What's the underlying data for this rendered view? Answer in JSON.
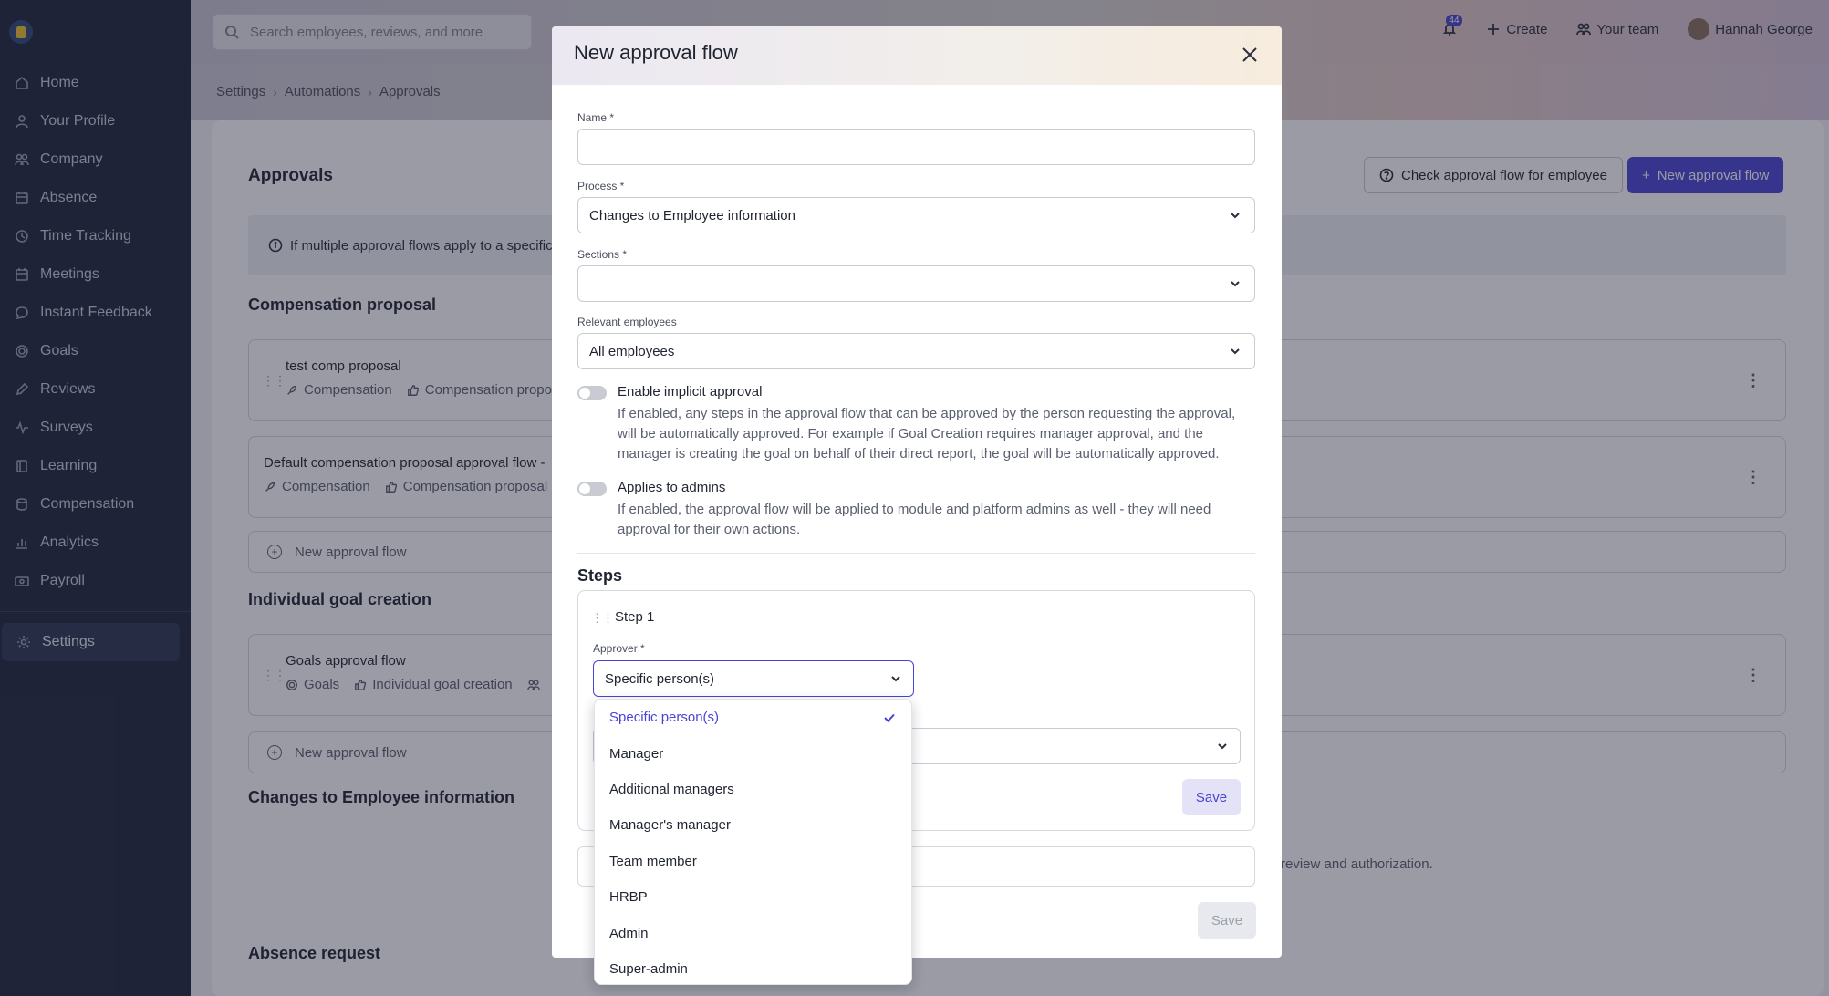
{
  "topbar": {
    "search_placeholder": "Search employees, reviews, and more",
    "notifications_count": "44",
    "create_label": "Create",
    "team_label": "Your team",
    "user_name": "Hannah George"
  },
  "sidebar": {
    "items": [
      {
        "label": "Home",
        "icon": "home-icon"
      },
      {
        "label": "Your Profile",
        "icon": "user-icon"
      },
      {
        "label": "Company",
        "icon": "people-icon"
      },
      {
        "label": "Absence",
        "icon": "calendar-icon"
      },
      {
        "label": "Time Tracking",
        "icon": "clock-icon"
      },
      {
        "label": "Meetings",
        "icon": "calendar-icon"
      },
      {
        "label": "Instant Feedback",
        "icon": "chat-icon"
      },
      {
        "label": "Goals",
        "icon": "target-icon"
      },
      {
        "label": "Reviews",
        "icon": "pen-icon"
      },
      {
        "label": "Surveys",
        "icon": "pulse-icon"
      },
      {
        "label": "Learning",
        "icon": "book-icon"
      },
      {
        "label": "Compensation",
        "icon": "coins-icon"
      },
      {
        "label": "Analytics",
        "icon": "chart-icon"
      },
      {
        "label": "Payroll",
        "icon": "money-icon"
      }
    ],
    "settings_label": "Settings"
  },
  "breadcrumb": [
    "Settings",
    "Automations",
    "Approvals"
  ],
  "page": {
    "title": "Approvals",
    "check_button": "Check approval flow for employee",
    "new_button": "New approval flow",
    "info_text": "If multiple approval flows apply to a specific",
    "sections": {
      "comp_title": "Compensation proposal",
      "comp_flow1_title": "test comp proposal",
      "comp_flow1_tag1": "Compensation",
      "comp_flow1_tag2": "Compensation propo",
      "comp_flow2_title": "Default compensation proposal approval flow -",
      "comp_flow2_tag1": "Compensation",
      "comp_flow2_tag2": "Compensation proposal",
      "add_flow": "New approval flow",
      "goal_title": "Individual goal creation",
      "goal_flow_title": "Goals approval flow",
      "goal_flow_tag1": "Goals",
      "goal_flow_tag2": "Individual goal creation",
      "emp_title": "Changes to Employee information",
      "emp_text_tail": "review and authorization.",
      "absence_title": "Absence request"
    }
  },
  "modal": {
    "title": "New approval flow",
    "name_label": "Name *",
    "name_value": "",
    "process_label": "Process *",
    "process_value": "Changes to Employee information",
    "sections_label": "Sections *",
    "sections_value": "",
    "relevant_label": "Relevant employees",
    "relevant_value": "All employees",
    "implicit_title": "Enable implicit approval",
    "implicit_desc": "If enabled, any steps in the approval flow that can be approved by the person requesting the approval, will be automatically approved. For example if Goal Creation requires manager approval, and the manager is creating the goal on behalf of their direct report, the goal will be automatically approved.",
    "admins_title": "Applies to admins",
    "admins_desc": "If enabled, the approval flow will be applied to module and platform admins as well - they will need approval for their own actions.",
    "steps_title": "Steps",
    "step1_title": "Step 1",
    "approver_label": "Approver *",
    "approver_value": "Specific person(s)",
    "save_inner": "Save",
    "save_footer": "Save"
  },
  "dropdown": {
    "options": [
      "Specific person(s)",
      "Manager",
      "Additional managers",
      "Manager's manager",
      "Team member",
      "HRBP",
      "Admin",
      "Super-admin"
    ],
    "selected": "Specific person(s)"
  },
  "colors": {
    "accent": "#4a44d6",
    "sidebar_bg": "#1e2539"
  }
}
